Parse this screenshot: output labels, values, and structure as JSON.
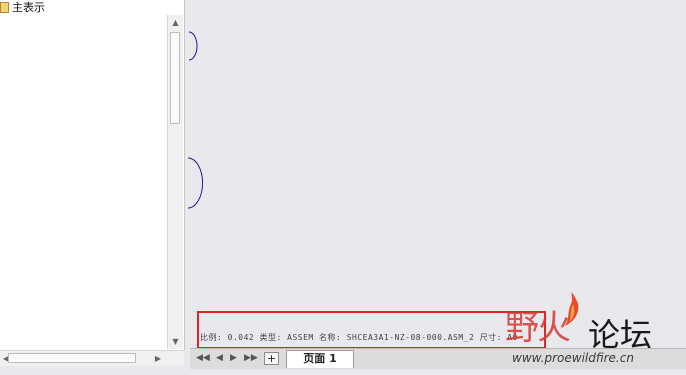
{
  "tree": {
    "root_label": "主表示"
  },
  "title_block": {
    "text": "比例: 0.042   类型: ASSEM   名称: SHCEA3A1-NZ-08-000.ASM_2   尺寸: A0"
  },
  "page_nav": {
    "add_label": "+",
    "tab_label": "页面 1"
  },
  "watermark": {
    "cn_red": "野火",
    "cn_black": "论坛",
    "url": "www.proewildfire.cn"
  },
  "colors": {
    "highlight_box": "#e02525",
    "arc_stroke": "#1c1c8a"
  }
}
